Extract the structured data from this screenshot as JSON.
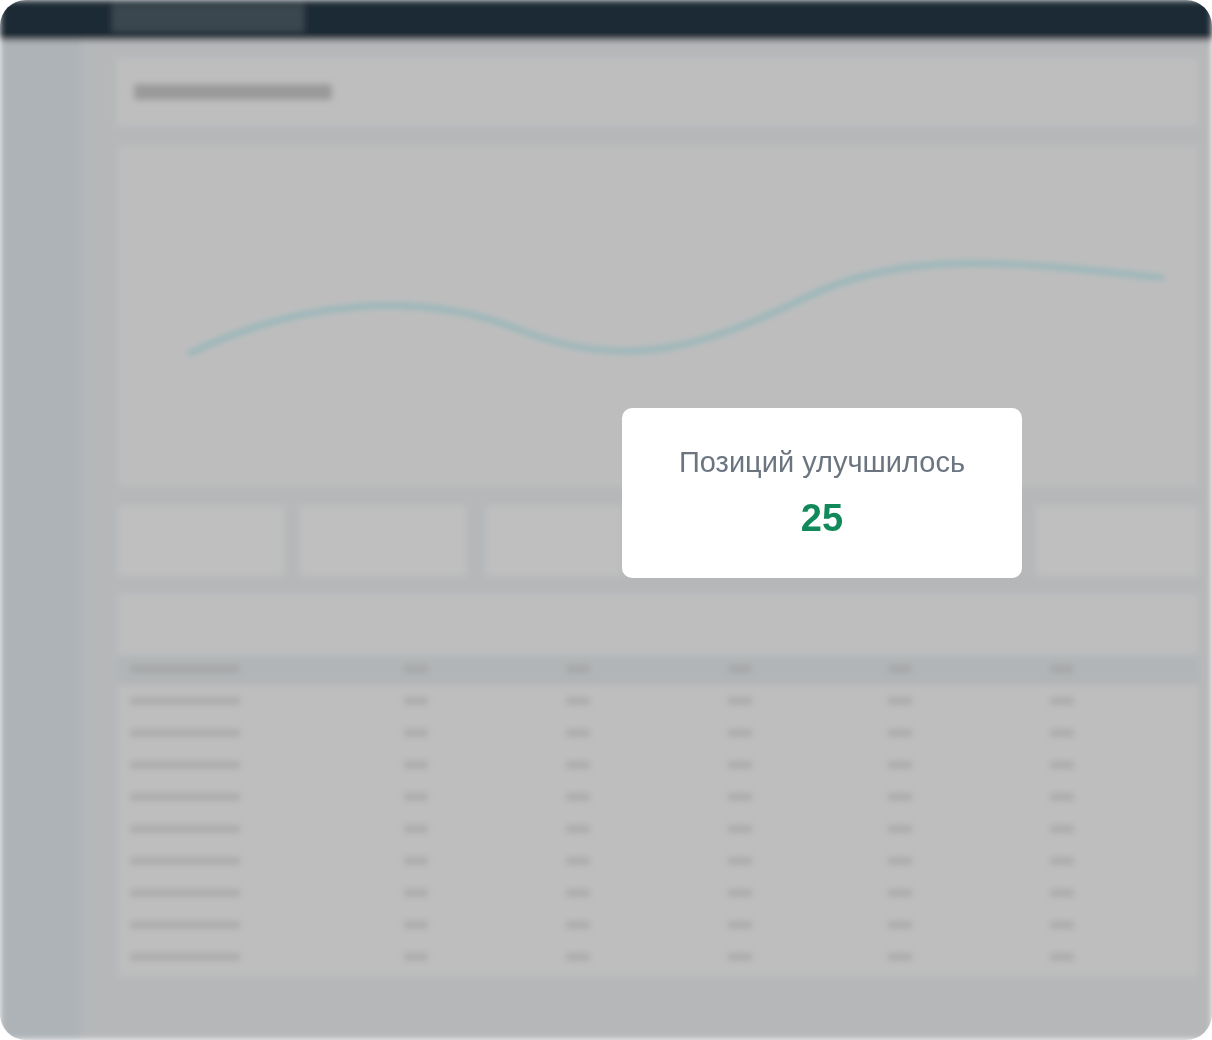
{
  "popup_card": {
    "title": "Позиций улучшилось",
    "value": "25"
  }
}
